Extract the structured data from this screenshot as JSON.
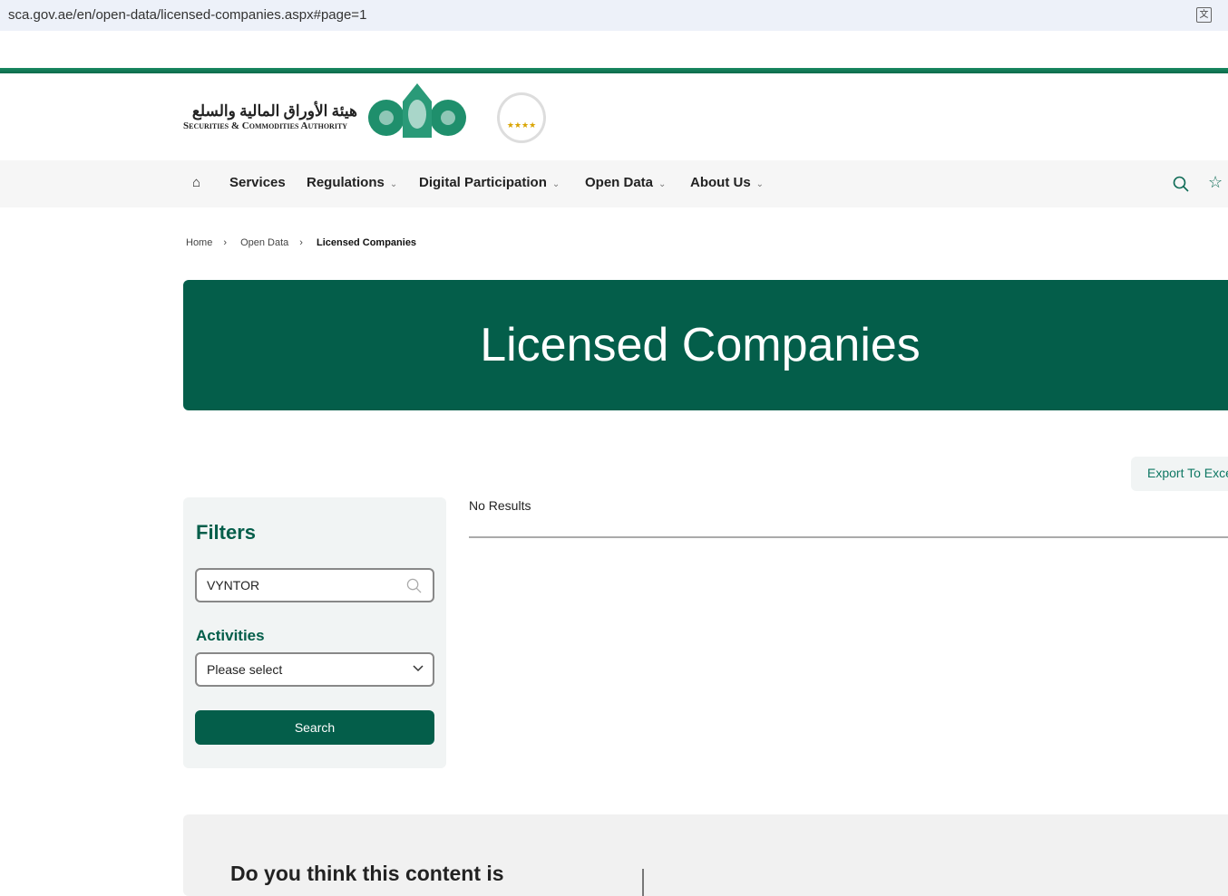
{
  "browser": {
    "url": "sca.gov.ae/en/open-data/licensed-companies.aspx#page=1"
  },
  "header": {
    "logo_ar": "هيئة الأوراق المالية والسلع",
    "logo_en": "Securities & Commodities Authority",
    "award": "★★★★"
  },
  "nav": {
    "items": [
      {
        "label": "Services"
      },
      {
        "label": "Regulations"
      },
      {
        "label": "Digital Participation"
      },
      {
        "label": "Open Data"
      },
      {
        "label": "About Us"
      }
    ]
  },
  "breadcrumb": [
    "Home",
    "Open Data",
    "Licensed Companies"
  ],
  "hero": {
    "title": "Licensed Companies"
  },
  "actions": {
    "export": "Export To Excel"
  },
  "filters": {
    "title": "Filters",
    "search_value": "VYNTOR",
    "activities_label": "Activities",
    "activities_value": "Please select",
    "search_button": "Search"
  },
  "results": {
    "status": "No Results"
  },
  "feedback": {
    "question": "Do you think this content is"
  }
}
